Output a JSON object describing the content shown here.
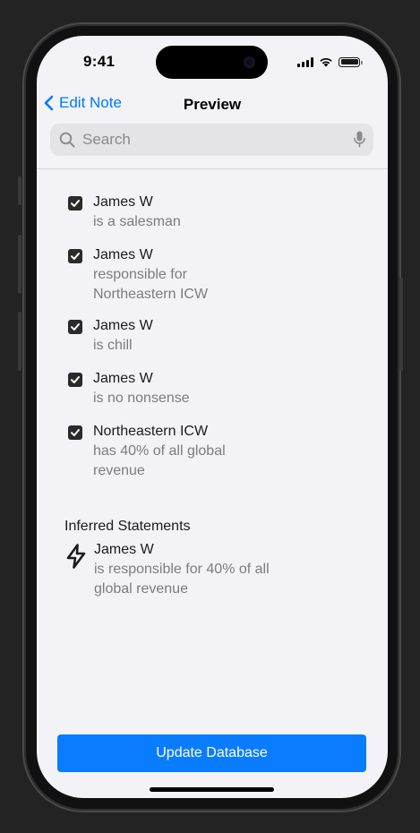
{
  "status_bar": {
    "time": "9:41"
  },
  "navbar": {
    "back_label": "Edit Note",
    "title": "Preview"
  },
  "search": {
    "placeholder": "Search"
  },
  "statements": [
    {
      "subject": "James W",
      "predicate_lines": [
        "is a salesman"
      ],
      "checked": true
    },
    {
      "subject": "James W",
      "predicate_lines": [
        "responsible for",
        "Northeastern ICW"
      ],
      "checked": true
    },
    {
      "subject": "James W",
      "predicate_lines": [
        "is chill"
      ],
      "checked": true
    },
    {
      "subject": "James W",
      "predicate_lines": [
        "is no nonsense"
      ],
      "checked": true
    },
    {
      "subject": "Northeastern ICW",
      "predicate_lines": [
        "has 40% of all global",
        "revenue"
      ],
      "checked": true
    }
  ],
  "inferred": {
    "heading": "Inferred Statements",
    "icon": "lightning-bolt-icon",
    "subject": "James W",
    "predicate_lines": [
      "is responsible for 40% of all",
      "global revenue"
    ]
  },
  "actions": {
    "update_label": "Update Database"
  },
  "colors": {
    "accent": "#007aff",
    "button": "#0a7cff",
    "checkbox": "#2a2a2a",
    "secondary_text": "#7c7c80"
  }
}
